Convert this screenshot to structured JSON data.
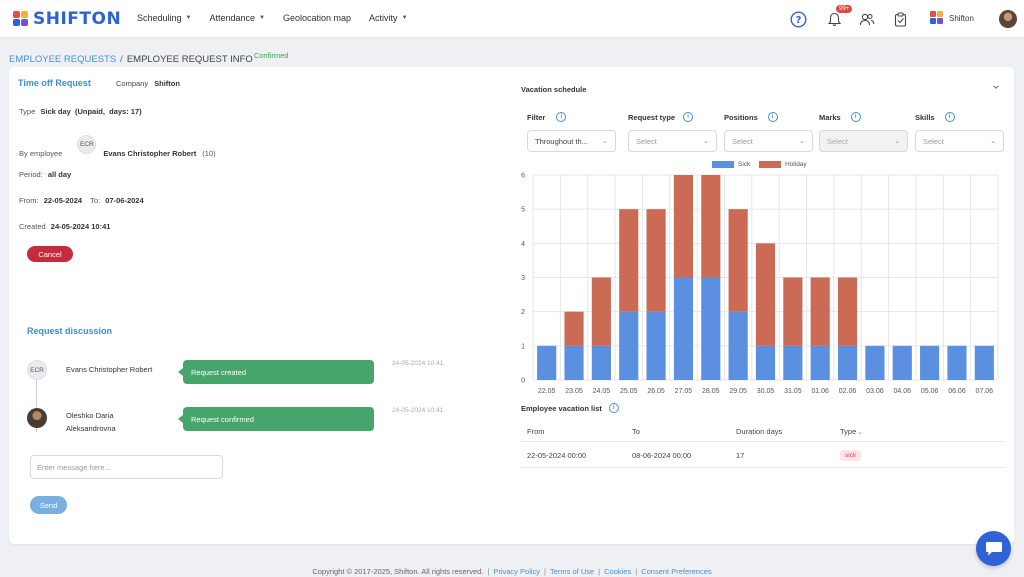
{
  "app": {
    "logo_text": "SHIFTON",
    "nav": [
      {
        "label": "Scheduling",
        "dropdown": true
      },
      {
        "label": "Attendance",
        "dropdown": true
      },
      {
        "label": "Geolocation map",
        "dropdown": false
      },
      {
        "label": "Activity",
        "dropdown": true
      }
    ],
    "notifications_badge": "99+",
    "company_chip": "Shifton",
    "accent_color": "#2d63d6"
  },
  "breadcrumb": {
    "parent": "EMPLOYEE REQUESTS",
    "separator": "/",
    "current": "EMPLOYEE REQUEST INFO",
    "status": "Confirmed"
  },
  "request": {
    "title": "Time off Request",
    "company_label": "Company",
    "company_value": "Shifton",
    "type_label": "Type",
    "type_value": "Sick day  (Unpaid,  days: 17)",
    "by_employee_label": "By employee",
    "employee_initials": "ECR",
    "employee_name": "Evans Christopher Robert",
    "employee_id": "(10)",
    "period_label": "Period:",
    "period_value": "all day",
    "from_label": "From:",
    "from_value": "22-05-2024",
    "to_label": "To:",
    "to_value": "07-06-2024",
    "created_label": "Created",
    "created_value": "24-05-2024 10:41",
    "cancel_label": "Cancel"
  },
  "discussion": {
    "title": "Request discussion",
    "entries": [
      {
        "initials": "ECR",
        "name": "Evans Christopher Robert",
        "message": "Request created",
        "time": "24-05-2024 10:41"
      },
      {
        "initials": "",
        "name": "Oleshko Daria\nAleksandrovna",
        "message": "Request confirmed",
        "time": "24-05-2024 10:41"
      }
    ],
    "input_placeholder": "Enter message here...",
    "send_label": "Send"
  },
  "vacation_schedule": {
    "title": "Vacation schedule",
    "filters": [
      {
        "label": "Filter",
        "value": "Throughout th...",
        "disabled": false,
        "has_value": true
      },
      {
        "label": "Request type",
        "value": "Select",
        "disabled": false,
        "has_value": false
      },
      {
        "label": "Positions",
        "value": "Select",
        "disabled": false,
        "has_value": false
      },
      {
        "label": "Marks",
        "value": "Select",
        "disabled": true,
        "has_value": false
      },
      {
        "label": "Skills",
        "value": "Select",
        "disabled": false,
        "has_value": false
      }
    ]
  },
  "chart_data": {
    "type": "bar",
    "stacked": true,
    "categories": [
      "22.05",
      "23.05",
      "24.05",
      "25.05",
      "26.05",
      "27.05",
      "28.05",
      "29.05",
      "30.05",
      "31.05",
      "01.06",
      "02.06",
      "03.06",
      "04.06",
      "05.06",
      "06.06",
      "07.06"
    ],
    "series": [
      {
        "name": "Sick",
        "color": "#5b8fdf",
        "values": [
          1,
          1,
          1,
          2,
          2,
          3,
          3,
          2,
          1,
          1,
          1,
          1,
          1,
          1,
          1,
          1,
          1
        ]
      },
      {
        "name": "Holiday",
        "color": "#cc6b55",
        "values": [
          0,
          1,
          2,
          3,
          3,
          3,
          3,
          3,
          3,
          2,
          2,
          2,
          0,
          0,
          0,
          0,
          0
        ]
      }
    ],
    "ylim": [
      0,
      6
    ],
    "yticks": [
      0,
      1,
      2,
      3,
      4,
      5,
      6
    ],
    "grid": true,
    "legend_position": "top"
  },
  "vacation_list": {
    "title": "Employee vacation list",
    "columns": [
      "From",
      "To",
      "Duration days",
      "Type"
    ],
    "rows": [
      {
        "from": "22-05-2024 00:00",
        "to": "08-06-2024 00:00",
        "duration": "17",
        "type": "sick"
      }
    ]
  },
  "footer": {
    "copyright": "Copyright © 2017-2025, Shifton. All rights reserved.",
    "links": [
      "Privacy Policy",
      "Terms of Use",
      "Cookies",
      "Consent Preferences"
    ]
  }
}
